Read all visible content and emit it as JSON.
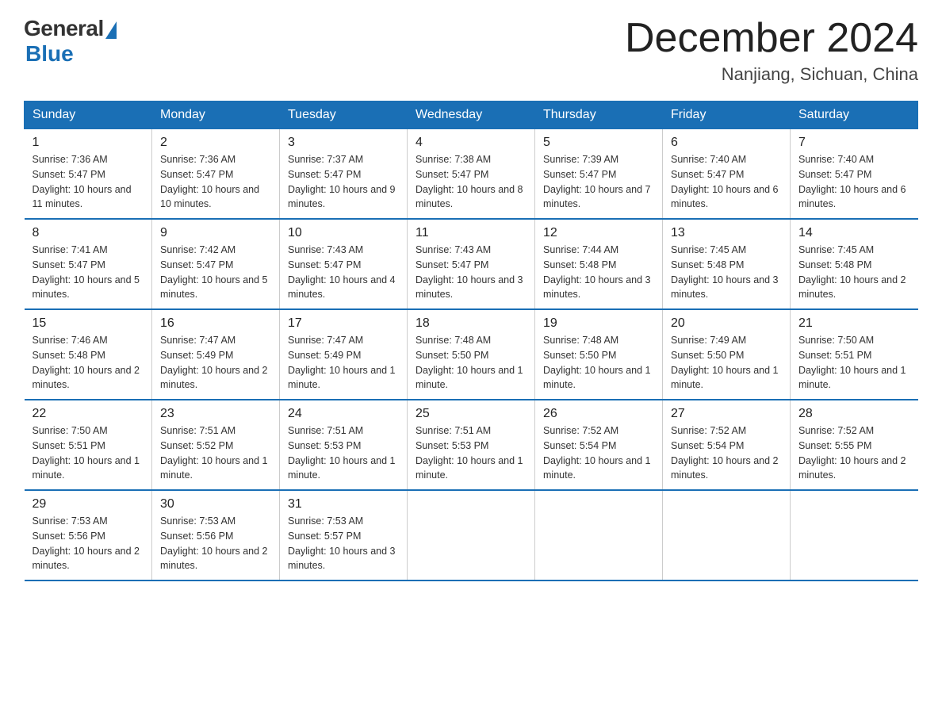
{
  "header": {
    "logo": {
      "general": "General",
      "blue": "Blue"
    },
    "title": "December 2024",
    "location": "Nanjiang, Sichuan, China"
  },
  "days_of_week": [
    "Sunday",
    "Monday",
    "Tuesday",
    "Wednesday",
    "Thursday",
    "Friday",
    "Saturday"
  ],
  "weeks": [
    [
      {
        "day": "1",
        "sunrise": "7:36 AM",
        "sunset": "5:47 PM",
        "daylight": "10 hours and 11 minutes."
      },
      {
        "day": "2",
        "sunrise": "7:36 AM",
        "sunset": "5:47 PM",
        "daylight": "10 hours and 10 minutes."
      },
      {
        "day": "3",
        "sunrise": "7:37 AM",
        "sunset": "5:47 PM",
        "daylight": "10 hours and 9 minutes."
      },
      {
        "day": "4",
        "sunrise": "7:38 AM",
        "sunset": "5:47 PM",
        "daylight": "10 hours and 8 minutes."
      },
      {
        "day": "5",
        "sunrise": "7:39 AM",
        "sunset": "5:47 PM",
        "daylight": "10 hours and 7 minutes."
      },
      {
        "day": "6",
        "sunrise": "7:40 AM",
        "sunset": "5:47 PM",
        "daylight": "10 hours and 6 minutes."
      },
      {
        "day": "7",
        "sunrise": "7:40 AM",
        "sunset": "5:47 PM",
        "daylight": "10 hours and 6 minutes."
      }
    ],
    [
      {
        "day": "8",
        "sunrise": "7:41 AM",
        "sunset": "5:47 PM",
        "daylight": "10 hours and 5 minutes."
      },
      {
        "day": "9",
        "sunrise": "7:42 AM",
        "sunset": "5:47 PM",
        "daylight": "10 hours and 5 minutes."
      },
      {
        "day": "10",
        "sunrise": "7:43 AM",
        "sunset": "5:47 PM",
        "daylight": "10 hours and 4 minutes."
      },
      {
        "day": "11",
        "sunrise": "7:43 AM",
        "sunset": "5:47 PM",
        "daylight": "10 hours and 3 minutes."
      },
      {
        "day": "12",
        "sunrise": "7:44 AM",
        "sunset": "5:48 PM",
        "daylight": "10 hours and 3 minutes."
      },
      {
        "day": "13",
        "sunrise": "7:45 AM",
        "sunset": "5:48 PM",
        "daylight": "10 hours and 3 minutes."
      },
      {
        "day": "14",
        "sunrise": "7:45 AM",
        "sunset": "5:48 PM",
        "daylight": "10 hours and 2 minutes."
      }
    ],
    [
      {
        "day": "15",
        "sunrise": "7:46 AM",
        "sunset": "5:48 PM",
        "daylight": "10 hours and 2 minutes."
      },
      {
        "day": "16",
        "sunrise": "7:47 AM",
        "sunset": "5:49 PM",
        "daylight": "10 hours and 2 minutes."
      },
      {
        "day": "17",
        "sunrise": "7:47 AM",
        "sunset": "5:49 PM",
        "daylight": "10 hours and 1 minute."
      },
      {
        "day": "18",
        "sunrise": "7:48 AM",
        "sunset": "5:50 PM",
        "daylight": "10 hours and 1 minute."
      },
      {
        "day": "19",
        "sunrise": "7:48 AM",
        "sunset": "5:50 PM",
        "daylight": "10 hours and 1 minute."
      },
      {
        "day": "20",
        "sunrise": "7:49 AM",
        "sunset": "5:50 PM",
        "daylight": "10 hours and 1 minute."
      },
      {
        "day": "21",
        "sunrise": "7:50 AM",
        "sunset": "5:51 PM",
        "daylight": "10 hours and 1 minute."
      }
    ],
    [
      {
        "day": "22",
        "sunrise": "7:50 AM",
        "sunset": "5:51 PM",
        "daylight": "10 hours and 1 minute."
      },
      {
        "day": "23",
        "sunrise": "7:51 AM",
        "sunset": "5:52 PM",
        "daylight": "10 hours and 1 minute."
      },
      {
        "day": "24",
        "sunrise": "7:51 AM",
        "sunset": "5:53 PM",
        "daylight": "10 hours and 1 minute."
      },
      {
        "day": "25",
        "sunrise": "7:51 AM",
        "sunset": "5:53 PM",
        "daylight": "10 hours and 1 minute."
      },
      {
        "day": "26",
        "sunrise": "7:52 AM",
        "sunset": "5:54 PM",
        "daylight": "10 hours and 1 minute."
      },
      {
        "day": "27",
        "sunrise": "7:52 AM",
        "sunset": "5:54 PM",
        "daylight": "10 hours and 2 minutes."
      },
      {
        "day": "28",
        "sunrise": "7:52 AM",
        "sunset": "5:55 PM",
        "daylight": "10 hours and 2 minutes."
      }
    ],
    [
      {
        "day": "29",
        "sunrise": "7:53 AM",
        "sunset": "5:56 PM",
        "daylight": "10 hours and 2 minutes."
      },
      {
        "day": "30",
        "sunrise": "7:53 AM",
        "sunset": "5:56 PM",
        "daylight": "10 hours and 2 minutes."
      },
      {
        "day": "31",
        "sunrise": "7:53 AM",
        "sunset": "5:57 PM",
        "daylight": "10 hours and 3 minutes."
      },
      null,
      null,
      null,
      null
    ]
  ],
  "labels": {
    "sunrise": "Sunrise:",
    "sunset": "Sunset:",
    "daylight": "Daylight:"
  }
}
